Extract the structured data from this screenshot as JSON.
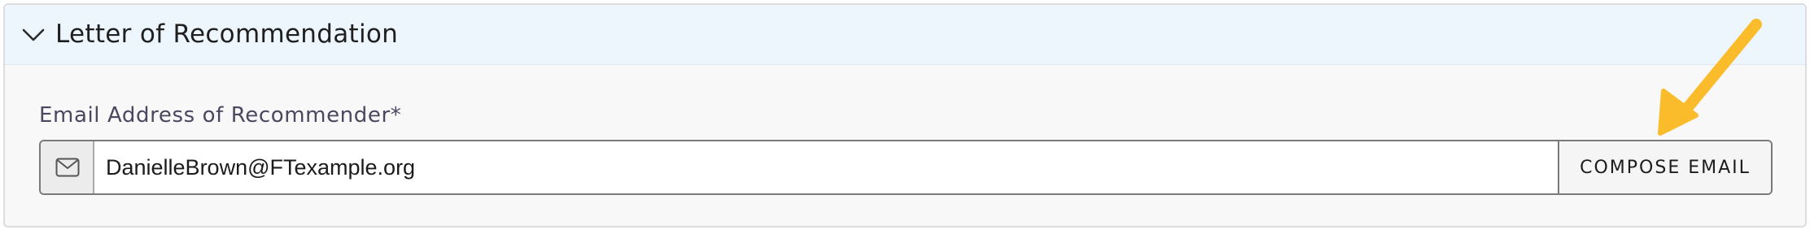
{
  "section": {
    "title": "Letter of Recommendation",
    "expand_icon": "chevron-down-icon"
  },
  "form": {
    "email_label": "Email Address of Recommender*",
    "email_icon": "envelope-icon",
    "email_value": "DanielleBrown@FTexample.org",
    "compose_label": "COMPOSE EMAIL"
  },
  "annotation": {
    "arrow_color": "#FBBC2C",
    "arrow_icon": "arrow-down-left-icon"
  }
}
